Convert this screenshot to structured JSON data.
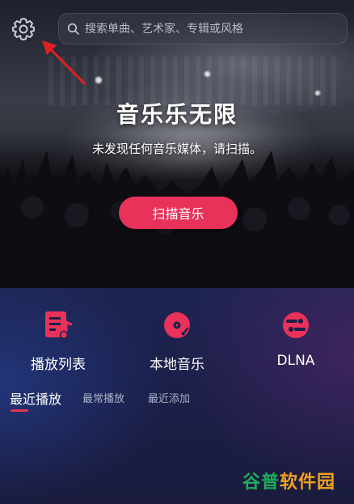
{
  "header": {
    "settings_icon": "gear-icon",
    "search": {
      "placeholder": "搜索单曲、艺术家、专辑或风格",
      "value": "",
      "icon": "search-icon"
    }
  },
  "hero": {
    "title": "音乐乐无限",
    "subtitle": "未发现任何音乐媒体，请扫描。",
    "scan_button": "扫描音乐"
  },
  "features": [
    {
      "label": "播放列表",
      "icon": "playlist-icon"
    },
    {
      "label": "本地音乐",
      "icon": "vinyl-record-icon"
    },
    {
      "label": "DLNA",
      "icon": "dlna-icon"
    }
  ],
  "tabs": [
    {
      "label": "最近播放",
      "active": true
    },
    {
      "label": "最常播放",
      "active": false
    },
    {
      "label": "最近添加",
      "active": false
    }
  ],
  "watermark": {
    "part1": "谷普",
    "part2": "软件园"
  },
  "colors": {
    "accent": "#e8325a",
    "annotation_arrow": "#e02020",
    "background": "#1a1d3a"
  }
}
